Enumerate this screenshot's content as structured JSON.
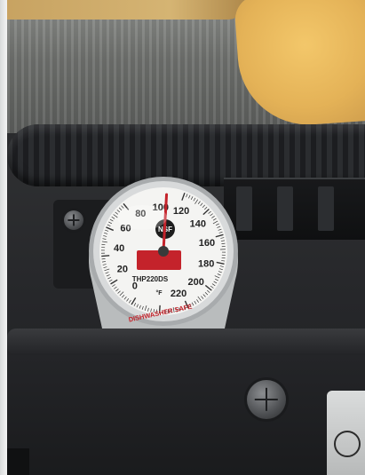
{
  "thermometer": {
    "brand": "NSF",
    "model": "THP220DS",
    "caption": "DISHWASHER SAFE",
    "unit": "°F",
    "scale_labels": [
      "0",
      "20",
      "40",
      "60",
      "80",
      "100",
      "120",
      "140",
      "160",
      "180",
      "200",
      "220"
    ],
    "reading_f": 105,
    "colors": {
      "needle": "#c4232b",
      "face": "#f4f4f2",
      "bezel": "#c9cbcc"
    }
  }
}
